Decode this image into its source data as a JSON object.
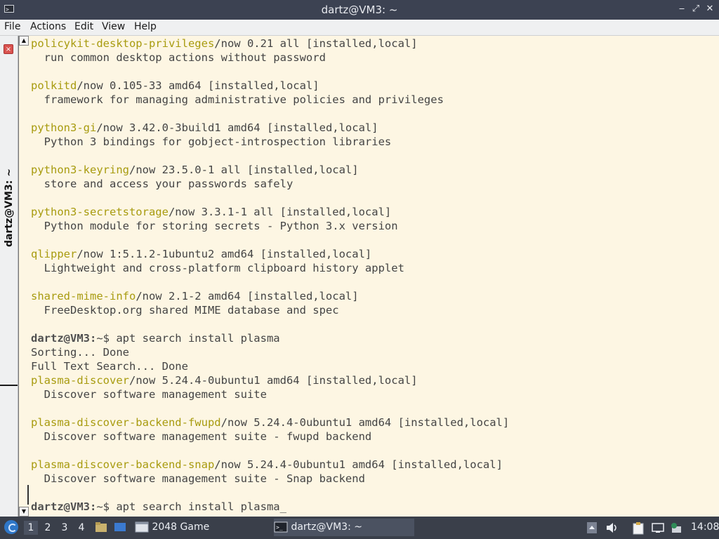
{
  "window": {
    "title": "dartz@VM3: ~",
    "controls": {
      "minimize": "‒",
      "maximize": "⤢",
      "close": "✕"
    }
  },
  "menu": [
    "File",
    "Actions",
    "Edit",
    "View",
    "Help"
  ],
  "tab": {
    "label": "dartz@VM3: ~",
    "close_glyph": "×"
  },
  "terminal": {
    "lines": [
      {
        "pkg": "policykit-desktop-privileges",
        "text": "/now 0.21 all [installed,local]"
      },
      {
        "text": "  run common desktop actions without password"
      },
      {
        "text": ""
      },
      {
        "pkg": "polkitd",
        "text": "/now 0.105-33 amd64 [installed,local]"
      },
      {
        "text": "  framework for managing administrative policies and privileges"
      },
      {
        "text": ""
      },
      {
        "pkg": "python3-gi",
        "text": "/now 3.42.0-3build1 amd64 [installed,local]"
      },
      {
        "text": "  Python 3 bindings for gobject-introspection libraries"
      },
      {
        "text": ""
      },
      {
        "pkg": "python3-keyring",
        "text": "/now 23.5.0-1 all [installed,local]"
      },
      {
        "text": "  store and access your passwords safely"
      },
      {
        "text": ""
      },
      {
        "pkg": "python3-secretstorage",
        "text": "/now 3.3.1-1 all [installed,local]"
      },
      {
        "text": "  Python module for storing secrets - Python 3.x version"
      },
      {
        "text": ""
      },
      {
        "pkg": "qlipper",
        "text": "/now 1:5.1.2-1ubuntu2 amd64 [installed,local]"
      },
      {
        "text": "  Lightweight and cross-platform clipboard history applet"
      },
      {
        "text": ""
      },
      {
        "pkg": "shared-mime-info",
        "text": "/now 2.1-2 amd64 [installed,local]"
      },
      {
        "text": "  FreeDesktop.org shared MIME database and spec"
      },
      {
        "text": ""
      },
      {
        "prompt": "dartz@VM3:",
        "text": "~$ apt search install plasma"
      },
      {
        "text": "Sorting... Done"
      },
      {
        "text": "Full Text Search... Done"
      },
      {
        "pkg": "plasma-discover",
        "text": "/now 5.24.4-0ubuntu1 amd64 [installed,local]"
      },
      {
        "text": "  Discover software management suite"
      },
      {
        "text": ""
      },
      {
        "pkg": "plasma-discover-backend-fwupd",
        "text": "/now 5.24.4-0ubuntu1 amd64 [installed,local]"
      },
      {
        "text": "  Discover software management suite - fwupd backend"
      },
      {
        "text": ""
      },
      {
        "pkg": "plasma-discover-backend-snap",
        "text": "/now 5.24.4-0ubuntu1 amd64 [installed,local]"
      },
      {
        "text": "  Discover software management suite - Snap backend"
      },
      {
        "text": ""
      },
      {
        "prompt": "dartz@VM3:",
        "text": "~$ apt search install plasma_"
      }
    ]
  },
  "taskbar": {
    "workspaces": [
      "1",
      "2",
      "3",
      "4"
    ],
    "active_workspace": "1",
    "tasks": [
      {
        "label": "2048 Game",
        "icon": "window-icon"
      },
      {
        "label": "dartz@VM3: ~",
        "icon": "terminal-icon"
      }
    ],
    "clock": "14:08"
  }
}
